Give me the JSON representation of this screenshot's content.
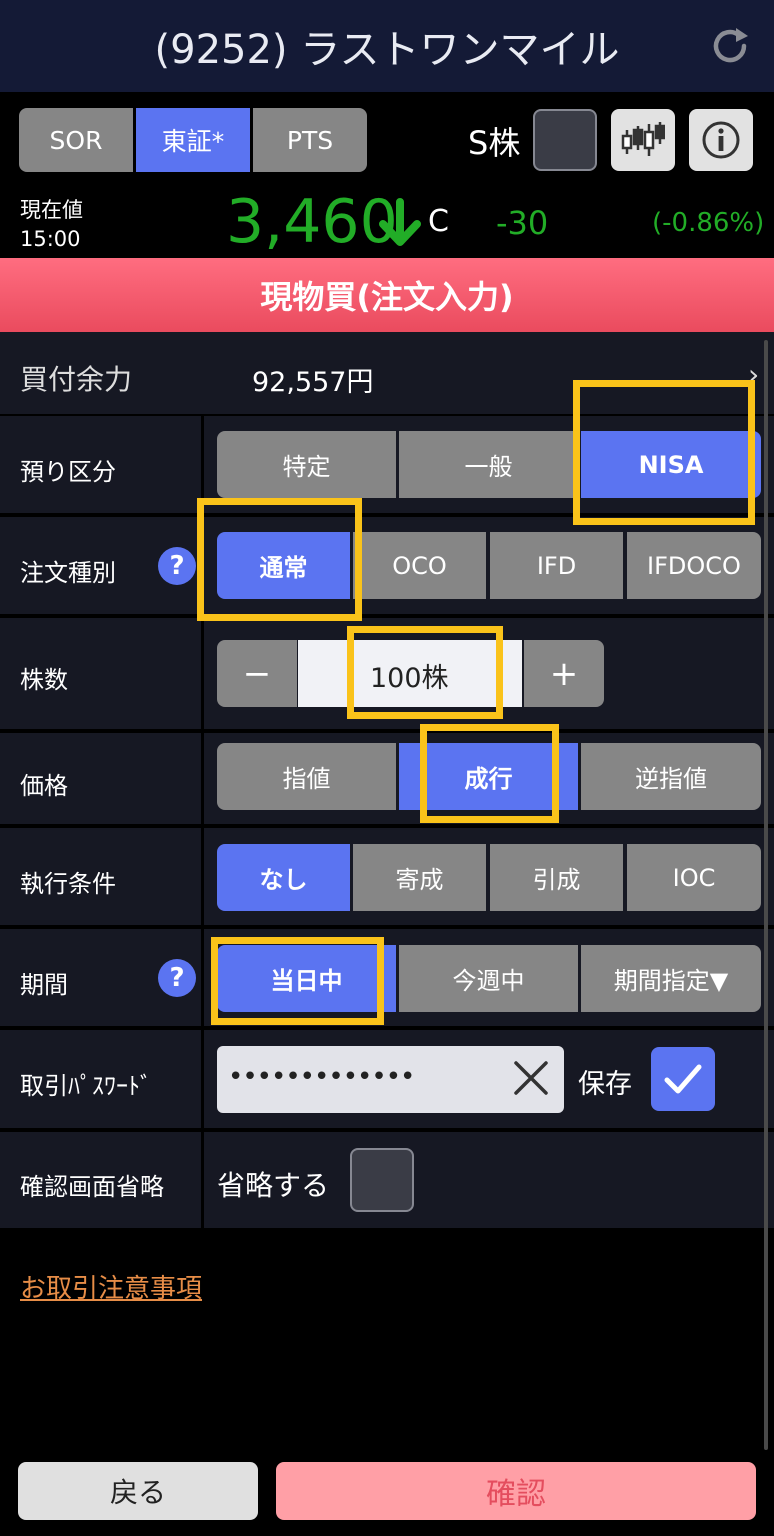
{
  "header": {
    "title": "(9252) ラストワンマイル",
    "refresh_icon": "refresh-icon"
  },
  "market_tabs": [
    {
      "label": "SOR",
      "selected": false
    },
    {
      "label": "東証*",
      "selected": true
    },
    {
      "label": "PTS",
      "selected": false
    }
  ],
  "s_stock": {
    "label": "S株",
    "checked": false
  },
  "tools": {
    "chart_icon": "candlestick-chart-icon",
    "info_icon": "info-icon"
  },
  "price": {
    "label_line1": "現在値",
    "label_line2": "15:00",
    "value": "3,460",
    "flag": "C",
    "change": "-30",
    "change_pct": "(-0.86%)",
    "color_down": "#22ad27"
  },
  "banner": {
    "title": "現物買(注文入力)",
    "color": "#ea4b5e"
  },
  "buying_power": {
    "label": "買付余力",
    "value": "92,557円",
    "chevron": "›"
  },
  "rows": {
    "account": {
      "label": "預り区分",
      "options": [
        "特定",
        "一般",
        "NISA"
      ],
      "selected": "NISA"
    },
    "order_type": {
      "label": "注文種別",
      "help": "?",
      "options": [
        "通常",
        "OCO",
        "IFD",
        "IFDOCO"
      ],
      "selected": "通常"
    },
    "quantity": {
      "label": "株数",
      "minus": "−",
      "value": "100株",
      "plus": "+"
    },
    "price": {
      "label": "価格",
      "options": [
        "指値",
        "成行",
        "逆指値"
      ],
      "selected": "成行"
    },
    "condition": {
      "label": "執行条件",
      "options": [
        "なし",
        "寄成",
        "引成",
        "IOC"
      ],
      "selected": "なし"
    },
    "period": {
      "label": "期間",
      "help": "?",
      "options": [
        "当日中",
        "今週中",
        "期間指定▼"
      ],
      "selected": "当日中"
    },
    "password": {
      "label": "取引ﾊﾟｽﾜｰﾄﾞ",
      "masked_value": "•••••••••••••",
      "save_label": "保存",
      "save_checked": true
    },
    "skip_confirm": {
      "label": "確認画面省略",
      "option_label": "省略する",
      "checked": false
    }
  },
  "notice_link": "お取引注意事項",
  "footer": {
    "back": "戻る",
    "confirm": "確認"
  },
  "colors": {
    "accent": "#5b74f1",
    "highlight": "#fac31a",
    "row_bg": "#161823",
    "option_bg": "#868686"
  }
}
